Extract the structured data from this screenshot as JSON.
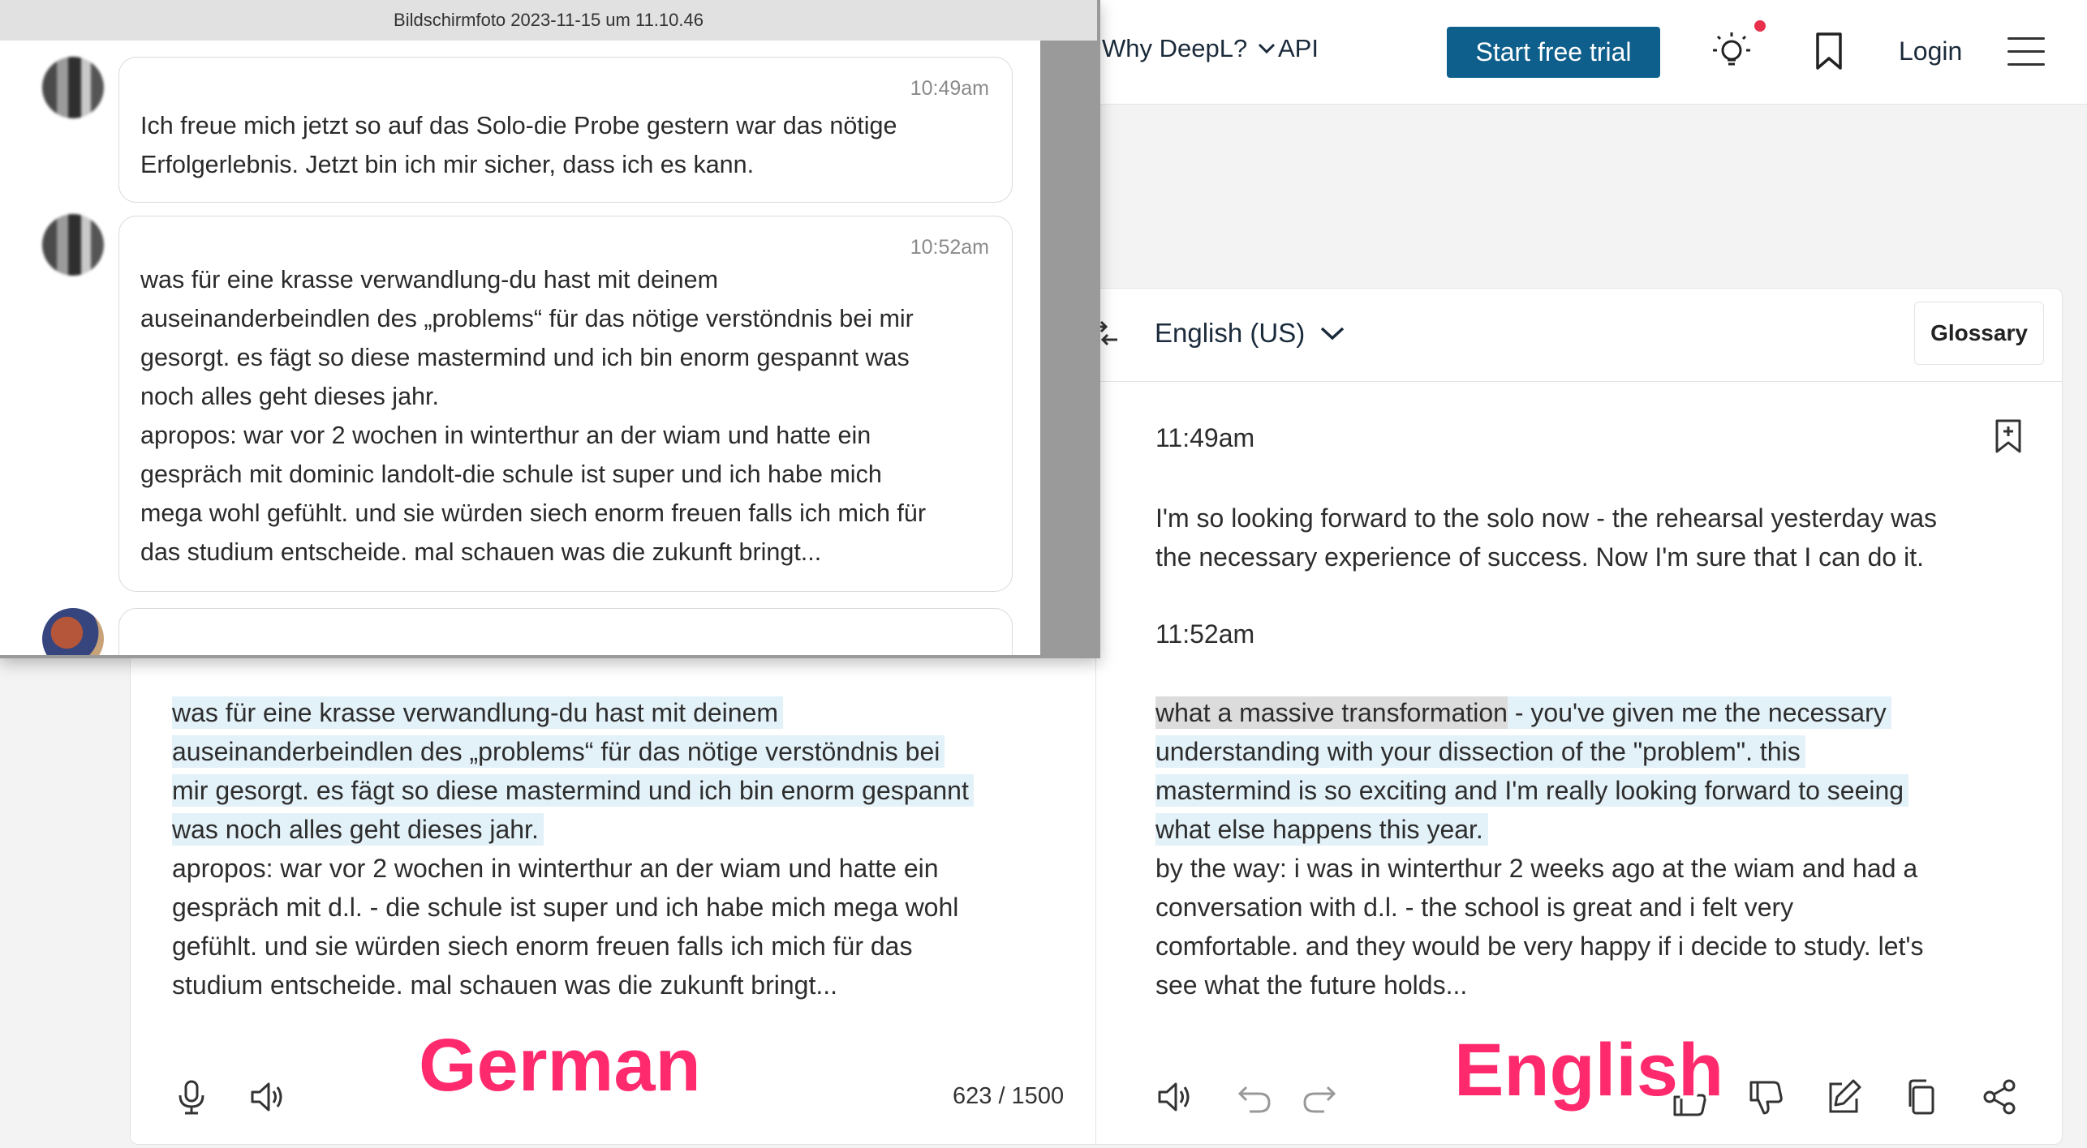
{
  "nav": {
    "why_deepl": "Why DeepL?",
    "api": "API",
    "trial_button": "Start free trial",
    "login": "Login"
  },
  "screenshot_window": {
    "title": "Bildschirmfoto 2023-11-15 um 11.10.46",
    "messages": [
      {
        "time": "10:49am",
        "lines": [
          "Ich freue mich jetzt so auf das Solo-die Probe gestern war das nötige",
          "Erfolgerlebnis. Jetzt bin ich mir sicher, dass ich es kann."
        ]
      },
      {
        "time": "10:52am",
        "lines": [
          "was für eine krasse verwandlung-du hast mit deinem",
          "auseinanderbeindlen des „problems“ für das nötige verstöndnis bei mir",
          "gesorgt. es fägt so diese mastermind und ich bin enorm gespannt was",
          "noch alles geht dieses jahr.",
          "apropos: war vor 2 wochen in winterthur an der wiam und hatte ein",
          "gespräch mit dominic landolt-die schule ist super und ich habe mich",
          "mega wohl gefühlt. und sie würden siech enorm freuen falls ich mich für",
          "das studium entscheide. mal schauen was die zukunft bringt..."
        ]
      }
    ]
  },
  "source": {
    "highlighted_lines": [
      "was für eine krasse verwandlung-du hast mit deinem",
      "auseinanderbeindlen des „problems“ für das nötige verstöndnis bei",
      "mir gesorgt. es fägt so diese mastermind und ich bin enorm gespannt",
      "was noch alles geht dieses jahr."
    ],
    "lines": [
      "apropos: war vor 2 wochen in winterthur an der wiam und hatte ein",
      "gespräch mit d.l. - die schule ist super und ich habe mich mega wohl",
      "gefühlt. und sie würden siech enorm freuen falls ich mich für das",
      "studium entscheide. mal schauen was die zukunft bringt..."
    ],
    "char_count": "623 / 1500"
  },
  "target": {
    "language": "English (US)",
    "glossary": "Glossary",
    "time1": "11:49am",
    "para1_lines": [
      "I'm so looking forward to the solo now - the rehearsal yesterday was",
      "the necessary experience of success. Now I'm sure that I can do it."
    ],
    "time2": "11:52am",
    "highlight_first_grey": "what a massive transformation",
    "highlight_first_rest": " - you've given me the necessary",
    "highlighted_lines": [
      "understanding with your dissection of the \"problem\". this",
      "mastermind is so exciting and I'm really looking forward to seeing",
      "what else happens this year."
    ],
    "lines": [
      "by the way: i was in winterthur 2 weeks ago at the wiam and had a",
      "conversation with d.l. - the school is great and i felt very",
      "comfortable. and they would be very happy if i decide to study. let's",
      "see what the future holds..."
    ]
  },
  "labels": {
    "german": "German",
    "english": "English"
  },
  "colors": {
    "trial_button": "#0f5f8c",
    "label_pink": "#ff2a6d",
    "highlight_blue": "#e3f1f8",
    "highlight_grey": "#dcdcdc"
  }
}
